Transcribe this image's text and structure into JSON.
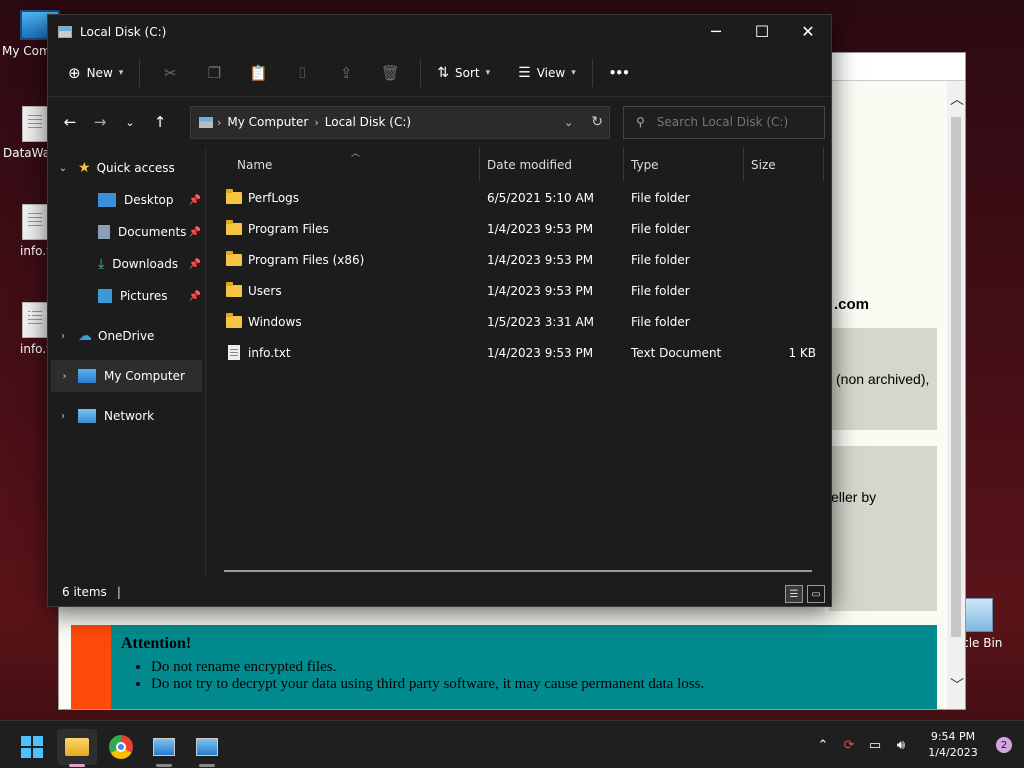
{
  "desktop": {
    "icons": [
      {
        "label": "My Com"
      },
      {
        "label": "DataWag"
      },
      {
        "label": "info.t"
      },
      {
        "label": "info.t"
      },
      {
        "label": "ycle Bin"
      }
    ]
  },
  "background_window": {
    "bold_text": ".com",
    "text1": "(non archived),",
    "text2": "eller by",
    "attention_title": "Attention!",
    "attention_items": [
      "Do not rename encrypted files.",
      "Do not try to decrypt your data using third party software, it may cause permanent data loss."
    ]
  },
  "explorer": {
    "title": "Local Disk (C:)",
    "toolbar": {
      "new_label": "New",
      "sort_label": "Sort",
      "view_label": "View",
      "more_label": "•••"
    },
    "address": {
      "segments": [
        "My Computer",
        "Local Disk (C:)"
      ]
    },
    "search": {
      "placeholder": "Search Local Disk (C:)"
    },
    "nav": {
      "quick_access": "Quick access",
      "desktop": "Desktop",
      "documents": "Documents",
      "downloads": "Downloads",
      "pictures": "Pictures",
      "onedrive": "OneDrive",
      "my_computer": "My Computer",
      "network": "Network"
    },
    "columns": {
      "name": "Name",
      "date": "Date modified",
      "type": "Type",
      "size": "Size"
    },
    "files": [
      {
        "name": "PerfLogs",
        "date": "6/5/2021 5:10 AM",
        "type": "File folder",
        "size": "",
        "kind": "folder"
      },
      {
        "name": "Program Files",
        "date": "1/4/2023 9:53 PM",
        "type": "File folder",
        "size": "",
        "kind": "folder"
      },
      {
        "name": "Program Files (x86)",
        "date": "1/4/2023 9:53 PM",
        "type": "File folder",
        "size": "",
        "kind": "folder"
      },
      {
        "name": "Users",
        "date": "1/4/2023 9:53 PM",
        "type": "File folder",
        "size": "",
        "kind": "folder"
      },
      {
        "name": "Windows",
        "date": "1/5/2023 3:31 AM",
        "type": "File folder",
        "size": "",
        "kind": "folder"
      },
      {
        "name": "info.txt",
        "date": "1/4/2023 9:53 PM",
        "type": "Text Document",
        "size": "1 KB",
        "kind": "text"
      }
    ],
    "status": {
      "item_count": "6 items"
    }
  },
  "taskbar": {
    "time": "9:54 PM",
    "date": "1/4/2023",
    "notification_count": "2"
  }
}
